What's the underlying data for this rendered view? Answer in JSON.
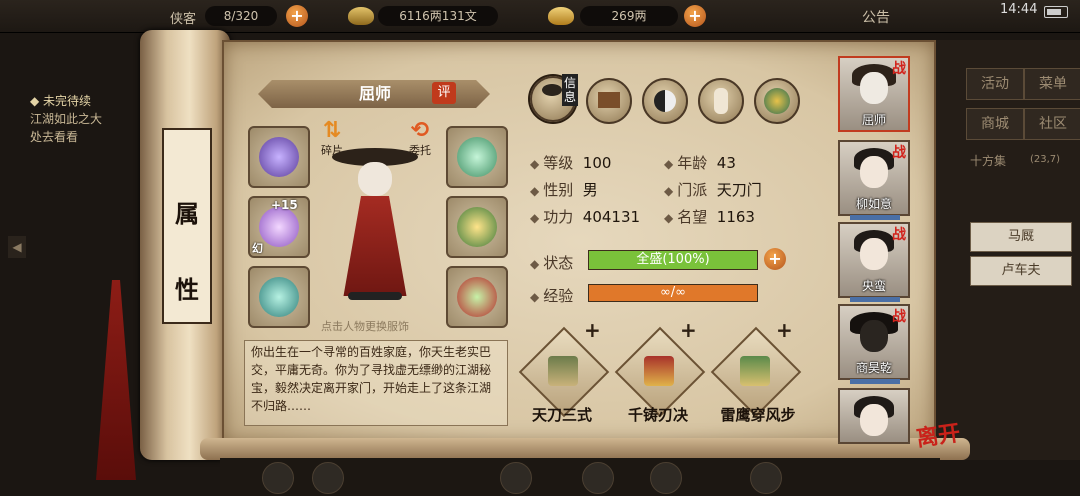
{
  "top_bar": {
    "capacity_label": "侠客",
    "capacity_value": "8/320",
    "money": "6116两131文",
    "gold": "269两",
    "notice_label": "公告",
    "time": "14:44"
  },
  "quest": {
    "title": "未完待续",
    "line1": "江湖如此之大",
    "line2": "处去看看"
  },
  "scroll_label": [
    "属",
    "性"
  ],
  "character": {
    "name": "屈师",
    "rate_badge": "评",
    "enhance": "+15",
    "slot_tag": "幻",
    "action_fragment": "碎片",
    "action_entrust": "委托",
    "change_tip": "点击人物更换服饰",
    "description": "你出生在一个寻常的百姓家庭，你天生老实巴交，平庸无奇。你为了寻找虚无缥缈的江湖秘宝，毅然决定离开家门，开始走上了这条江湖不归路……"
  },
  "tabs": {
    "active_label": "信息"
  },
  "stats": {
    "level_label": "等级",
    "level": "100",
    "age_label": "年龄",
    "age": "43",
    "gender_label": "性别",
    "gender": "男",
    "sect_label": "门派",
    "sect": "天刀门",
    "power_label": "功力",
    "power": "404131",
    "fame_label": "名望",
    "fame": "1163",
    "state_label": "状态",
    "state_text": "全盛(100%)",
    "state_fraction": 1.0,
    "exp_label": "经验",
    "exp_text": "∞/∞",
    "exp_fraction": 1.0
  },
  "skills": [
    {
      "name": "天刀三式",
      "plus": "+"
    },
    {
      "name": "千铸刃决",
      "plus": "+"
    },
    {
      "name": "雷鹰穿风步",
      "plus": "+"
    }
  ],
  "party": [
    {
      "name": "屈师",
      "tag": "战"
    },
    {
      "name": "柳如意",
      "tag": "战"
    },
    {
      "name": "央蛮",
      "tag": "战"
    },
    {
      "name": "商昊乾",
      "tag": "战"
    },
    {
      "name": "",
      "tag": ""
    }
  ],
  "right_menu": {
    "activity": "活动",
    "menu": "菜单",
    "shop": "商城",
    "community": "社区",
    "location": "十方集",
    "coords": "(23,7)",
    "stable": "马厩",
    "coachman": "卢车夫"
  },
  "leave_label": "离开",
  "colors": {
    "state_bar": "#7ac23a",
    "exp_bar": "#e0782a",
    "accent_red": "#c13b1f"
  }
}
